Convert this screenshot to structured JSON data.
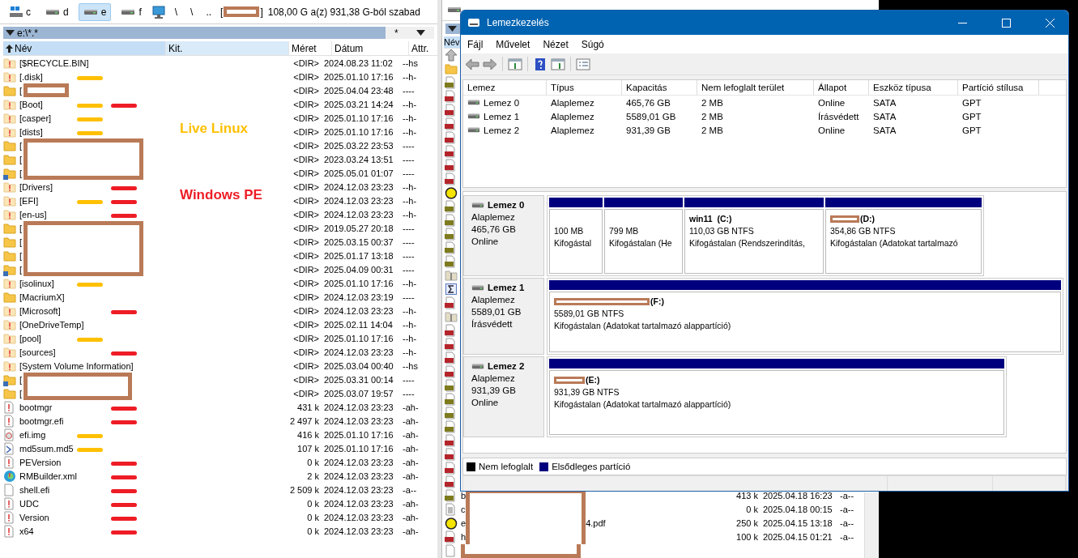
{
  "left": {
    "toolbar": {
      "drives": [
        {
          "label": "c",
          "kind": "system",
          "selected": false
        },
        {
          "label": "d",
          "kind": "drive",
          "selected": false
        },
        {
          "label": "e",
          "kind": "drive",
          "selected": true
        },
        {
          "label": "f",
          "kind": "drive",
          "selected": false
        }
      ],
      "network": "\\",
      "root": "\\",
      "parent": "..",
      "volume_open": "[",
      "volume_close": "]",
      "free_space": "108,00 G a(z) 931,38 G-ból szabad"
    },
    "path": "e:\\*.*",
    "path_filter": "*",
    "columns": [
      {
        "label": "Név",
        "sorted": true
      },
      {
        "label": "Kit.",
        "sorted": false
      },
      {
        "label": "Méret",
        "sorted": false
      },
      {
        "label": "Dátum",
        "sorted": false
      },
      {
        "label": "Attr.",
        "sorted": false
      }
    ],
    "rows": [
      {
        "kind": "hidden-folder",
        "name": "[$RECYCLE.BIN]",
        "size": "<DIR>",
        "date": "2024.08.23 11:02",
        "attr": "--hs"
      },
      {
        "kind": "hidden-folder",
        "name": "[.disk]",
        "size": "<DIR>",
        "date": "2025.01.10 17:16",
        "attr": "--h-",
        "marks": [
          {
            "kind": "linux"
          }
        ]
      },
      {
        "kind": "folder",
        "name": "[",
        "redacted": true,
        "size": "<DIR>",
        "date": "2025.04.04 23:48",
        "attr": "----"
      },
      {
        "kind": "hidden-folder",
        "name": "[Boot]",
        "size": "<DIR>",
        "date": "2025.03.21 14:24",
        "attr": "--h-",
        "marks": [
          {
            "kind": "linux"
          },
          {
            "kind": "pe"
          }
        ]
      },
      {
        "kind": "hidden-folder",
        "name": "[casper]",
        "size": "<DIR>",
        "date": "2025.01.10 17:16",
        "attr": "--h-",
        "marks": [
          {
            "kind": "linux"
          }
        ]
      },
      {
        "kind": "hidden-folder",
        "name": "[dists]",
        "size": "<DIR>",
        "date": "2025.01.10 17:16",
        "attr": "--h-",
        "marks": [
          {
            "kind": "linux"
          }
        ]
      },
      {
        "kind": "folder",
        "name": "[",
        "redacted": true,
        "size": "<DIR>",
        "date": "2025.03.22 23:53",
        "attr": "----"
      },
      {
        "kind": "folder",
        "name": "[",
        "redacted": true,
        "size": "<DIR>",
        "date": "2023.03.24 13:51",
        "attr": "----"
      },
      {
        "kind": "shared-folder",
        "name": "[",
        "redacted": true,
        "size": "<DIR>",
        "date": "2025.05.01 01:07",
        "attr": "----"
      },
      {
        "kind": "hidden-folder",
        "name": "[Drivers]",
        "size": "<DIR>",
        "date": "2024.12.03 23:23",
        "attr": "--h-",
        "marks": [
          {
            "kind": "pe"
          }
        ]
      },
      {
        "kind": "hidden-folder",
        "name": "[EFI]",
        "size": "<DIR>",
        "date": "2024.12.03 23:23",
        "attr": "--h-",
        "marks": [
          {
            "kind": "linux"
          },
          {
            "kind": "pe"
          }
        ]
      },
      {
        "kind": "hidden-folder",
        "name": "[en-us]",
        "size": "<DIR>",
        "date": "2024.12.03 23:23",
        "attr": "--h-",
        "marks": [
          {
            "kind": "pe"
          }
        ]
      },
      {
        "kind": "folder",
        "name": "[",
        "redacted": true,
        "size": "<DIR>",
        "date": "2019.05.27 20:18",
        "attr": "----"
      },
      {
        "kind": "folder",
        "name": "[",
        "redacted": true,
        "size": "<DIR>",
        "date": "2025.03.15 00:37",
        "attr": "----"
      },
      {
        "kind": "folder",
        "name": "[",
        "redacted": true,
        "size": "<DIR>",
        "date": "2025.01.17 13:18",
        "attr": "----"
      },
      {
        "kind": "shared-folder",
        "name": "[",
        "redacted": true,
        "size": "<DIR>",
        "date": "2025.04.09 00:31",
        "attr": "----"
      },
      {
        "kind": "hidden-folder",
        "name": "[isolinux]",
        "size": "<DIR>",
        "date": "2025.01.10 17:16",
        "attr": "--h-",
        "marks": [
          {
            "kind": "linux"
          }
        ]
      },
      {
        "kind": "folder",
        "name": "[MacriumX]",
        "size": "<DIR>",
        "date": "2024.12.03 23:19",
        "attr": "----"
      },
      {
        "kind": "hidden-folder",
        "name": "[Microsoft]",
        "size": "<DIR>",
        "date": "2024.12.03 23:23",
        "attr": "--h-",
        "marks": [
          {
            "kind": "pe"
          }
        ]
      },
      {
        "kind": "hidden-folder",
        "name": "[OneDriveTemp]",
        "size": "<DIR>",
        "date": "2025.02.11 14:04",
        "attr": "--h-"
      },
      {
        "kind": "hidden-folder",
        "name": "[pool]",
        "size": "<DIR>",
        "date": "2025.01.10 17:16",
        "attr": "--h-",
        "marks": [
          {
            "kind": "linux"
          }
        ]
      },
      {
        "kind": "hidden-folder",
        "name": "[sources]",
        "size": "<DIR>",
        "date": "2024.12.03 23:23",
        "attr": "--h-",
        "marks": [
          {
            "kind": "pe"
          }
        ]
      },
      {
        "kind": "hidden-folder",
        "name": "[System Volume Information]",
        "size": "<DIR>",
        "date": "2025.03.04 00:40",
        "attr": "--hs"
      },
      {
        "kind": "shared-folder",
        "name": "[",
        "redacted": true,
        "size": "<DIR>",
        "date": "2025.03.31 00:14",
        "attr": "----"
      },
      {
        "kind": "folder",
        "name": "[",
        "redacted": true,
        "size": "<DIR>",
        "date": "2025.03.07 19:57",
        "attr": "----"
      },
      {
        "kind": "hidden-file",
        "name": "bootmgr",
        "size": "431 k",
        "date": "2024.12.03 23:23",
        "attr": "-ah-",
        "marks": [
          {
            "kind": "pe"
          }
        ]
      },
      {
        "kind": "hidden-file",
        "name": "bootmgr.efi",
        "size": "2 497 k",
        "date": "2024.12.03 23:23",
        "attr": "-ah-",
        "marks": [
          {
            "kind": "pe"
          }
        ]
      },
      {
        "kind": "disc-image",
        "name": "efi.img",
        "size": "416 k",
        "date": "2025.01.10 17:16",
        "attr": "-ah-",
        "marks": [
          {
            "kind": "linux"
          }
        ]
      },
      {
        "kind": "checksum",
        "name": "md5sum.md5",
        "size": "107 k",
        "date": "2025.01.10 17:16",
        "attr": "-ah-",
        "marks": [
          {
            "kind": "linux"
          }
        ]
      },
      {
        "kind": "hidden-file",
        "name": "PEVersion",
        "size": "0 k",
        "date": "2024.12.03 23:23",
        "attr": "-ah-",
        "marks": [
          {
            "kind": "pe"
          }
        ]
      },
      {
        "kind": "web",
        "name": "RMBuilder.xml",
        "size": "2 k",
        "date": "2024.12.03 23:23",
        "attr": "-ah-",
        "marks": [
          {
            "kind": "pe"
          }
        ]
      },
      {
        "kind": "file",
        "name": "shell.efi",
        "size": "2 509 k",
        "date": "2024.12.03 23:23",
        "attr": "-a--",
        "marks": [
          {
            "kind": "pe"
          }
        ]
      },
      {
        "kind": "hidden-file",
        "name": "UDC",
        "size": "0 k",
        "date": "2024.12.03 23:23",
        "attr": "-ah-",
        "marks": [
          {
            "kind": "pe"
          }
        ]
      },
      {
        "kind": "hidden-file",
        "name": "Version",
        "size": "0 k",
        "date": "2024.12.03 23:23",
        "attr": "-ah-",
        "marks": [
          {
            "kind": "pe"
          }
        ]
      },
      {
        "kind": "hidden-file",
        "name": "x64",
        "size": "0 k",
        "date": "2024.12.03 23:23",
        "attr": "-ah-",
        "marks": [
          {
            "kind": "pe"
          }
        ]
      }
    ]
  },
  "annotations": [
    {
      "text": "Live Linux",
      "kind": "linux",
      "color": "#ffc000"
    },
    {
      "text": "Windows PE",
      "kind": "pe",
      "color": "#ee1c25"
    }
  ],
  "right": {
    "columns": [
      {
        "label": "Név"
      }
    ],
    "rows": [
      {
        "kind": "up"
      },
      {
        "kind": "folder"
      },
      {
        "kind": "jpg"
      },
      {
        "kind": "png"
      },
      {
        "kind": "png"
      },
      {
        "kind": "png"
      },
      {
        "kind": "png"
      },
      {
        "kind": "png"
      },
      {
        "kind": "png"
      },
      {
        "kind": "png"
      },
      {
        "kind": "pdf"
      },
      {
        "kind": "jpg"
      },
      {
        "kind": "jpg"
      },
      {
        "kind": "jpg"
      },
      {
        "kind": "jpg"
      },
      {
        "kind": "jpg"
      },
      {
        "kind": "archive"
      },
      {
        "kind": "sum"
      },
      {
        "kind": "png"
      },
      {
        "kind": "archive"
      },
      {
        "kind": "png"
      },
      {
        "kind": "png"
      },
      {
        "kind": "png"
      },
      {
        "kind": "png"
      },
      {
        "kind": "jpg"
      },
      {
        "kind": "jpg"
      },
      {
        "kind": "jpg"
      },
      {
        "kind": "jpg"
      },
      {
        "kind": "png"
      },
      {
        "kind": "png"
      },
      {
        "kind": "png"
      },
      {
        "kind": "png"
      },
      {
        "kind": "jpg",
        "name": "b",
        "redacted": true,
        "size": "413 k",
        "date": "2025.04.18 16:23",
        "attr": "-a--"
      },
      {
        "kind": "doc",
        "name": "c",
        "redacted": true,
        "size": "0 k",
        "date": "2025.04.18 00:15",
        "attr": "-a--"
      },
      {
        "kind": "pdf",
        "name": "e",
        "redacted": true,
        "name_end": "4.pdf",
        "size": "250 k",
        "date": "2025.04.15 13:18",
        "attr": "-a--"
      },
      {
        "kind": "png",
        "name": "h",
        "redacted": true,
        "size": "100 k",
        "date": "2025.04.15 01:21",
        "attr": "-a--"
      },
      {
        "kind": "file",
        "redacted": true
      }
    ]
  },
  "dialog": {
    "title": "Lemezkezelés",
    "menu": [
      "Fájl",
      "Művelet",
      "Nézet",
      "Súgó"
    ],
    "volumes": {
      "columns": [
        "Lemez",
        "Típus",
        "Kapacitás",
        "Nem lefoglalt terület",
        "Állapot",
        "Eszköz típusa",
        "Partíció stílusa"
      ],
      "rows": [
        {
          "cells": [
            "Lemez 0",
            "Alaplemez",
            "465,76 GB",
            "2 MB",
            "Online",
            "SATA",
            "GPT"
          ]
        },
        {
          "cells": [
            "Lemez 1",
            "Alaplemez",
            "5589,01 GB",
            "2 MB",
            "Írásvédett",
            "SATA",
            "GPT"
          ]
        },
        {
          "cells": [
            "Lemez 2",
            "Alaplemez",
            "931,39 GB",
            "2 MB",
            "Online",
            "SATA",
            "GPT"
          ]
        }
      ]
    },
    "disks": [
      {
        "name": "Lemez 0",
        "type": "Alaplemez",
        "size": "465,76 GB",
        "status": "Online",
        "partitions": [
          {
            "kind": "primary",
            "size": "100 MB",
            "status": "Kifogástal"
          },
          {
            "kind": "primary",
            "size": "799 MB",
            "status": "Kifogástalan (He"
          },
          {
            "kind": "primary",
            "title": "win11  (C:)",
            "size": "110,03 GB NTFS",
            "status": "Kifogástalan (Rendszerindítás,"
          },
          {
            "kind": "primary",
            "title": "(D:)",
            "title_redacted": true,
            "size": "354,86 GB NTFS",
            "status": "Kifogástalan (Adatokat tartalmazó"
          }
        ]
      },
      {
        "name": "Lemez 1",
        "type": "Alaplemez",
        "size": "5589,01 GB",
        "status": "Írásvédett",
        "partitions": [
          {
            "kind": "primary",
            "title": "(F:)",
            "title_redacted": true,
            "size": "5589,01 GB NTFS",
            "status": "Kifogástalan (Adatokat tartalmazó alappartíció)"
          }
        ]
      },
      {
        "name": "Lemez 2",
        "type": "Alaplemez",
        "size": "931,39 GB",
        "status": "Online",
        "partitions": [
          {
            "kind": "primary",
            "title": "(E:)",
            "title_redacted": true,
            "size": "931,39 GB NTFS",
            "status": "Kifogástalan (Adatokat tartalmazó alappartíció)"
          }
        ]
      }
    ],
    "legend": [
      {
        "label": "Nem lefoglalt",
        "kind": "unallocated"
      },
      {
        "label": "Elsődleges partíció",
        "kind": "primary"
      }
    ]
  }
}
